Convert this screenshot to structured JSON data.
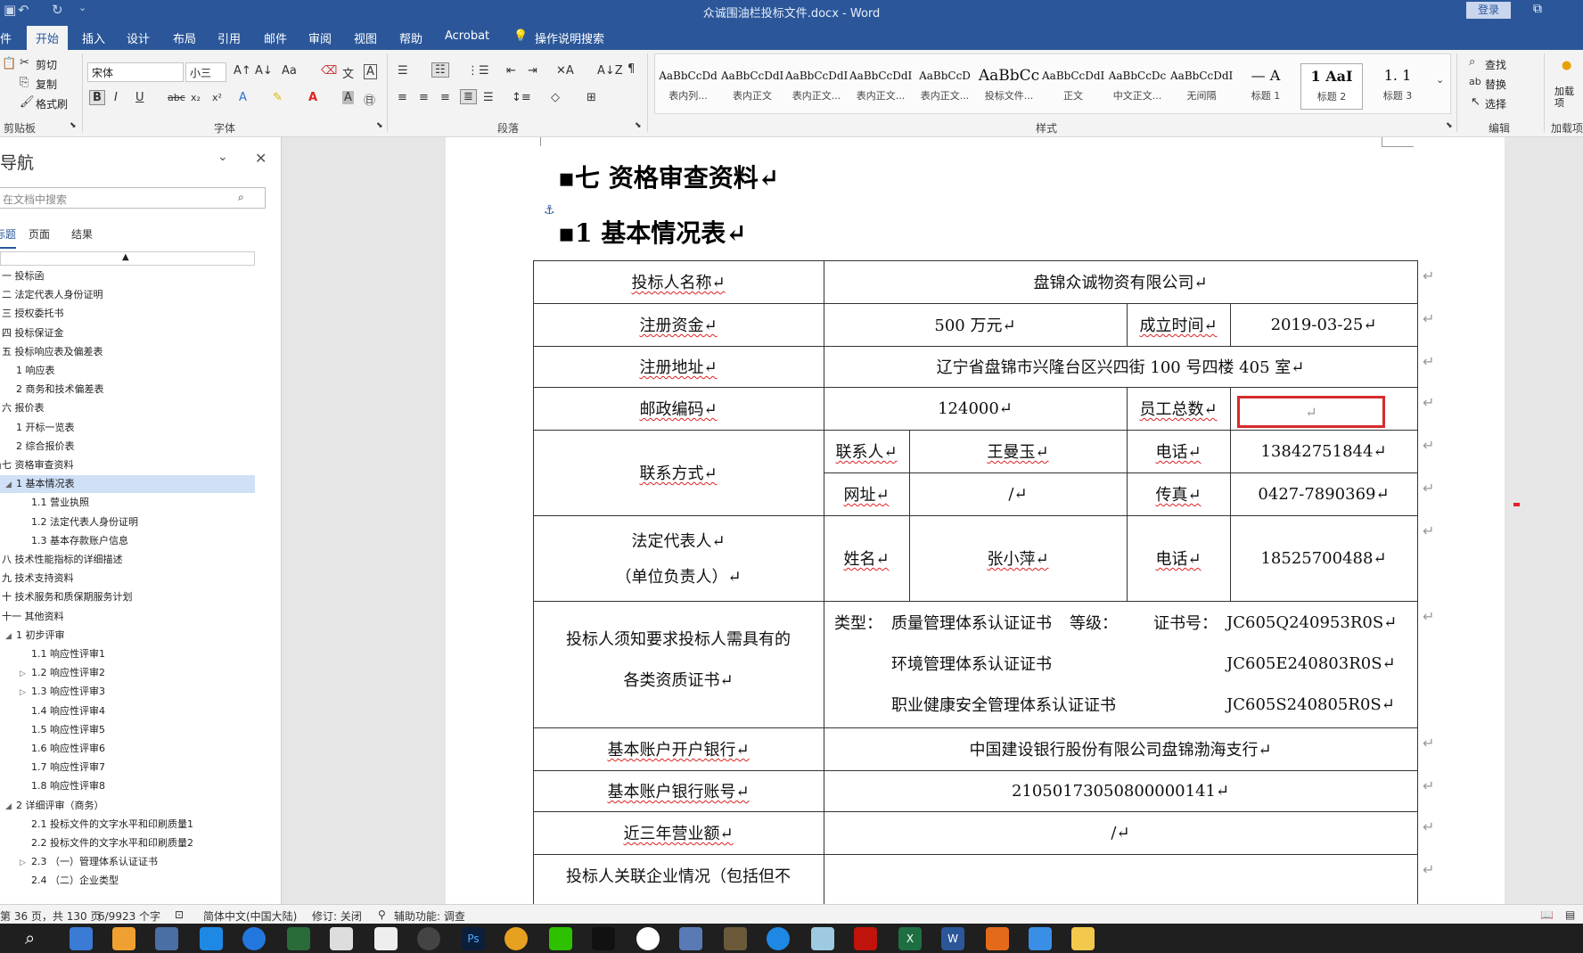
{
  "titlebar": {
    "title": "众诚围油栏投标文件.docx  -  Word",
    "login": "登录"
  },
  "tabs": [
    "件",
    "开始",
    "插入",
    "设计",
    "布局",
    "引用",
    "邮件",
    "审阅",
    "视图",
    "帮助",
    "Acrobat",
    "操作说明搜索"
  ],
  "ribbon": {
    "clipboard": {
      "cut": "剪切",
      "copy": "复制",
      "format_painter": "格式刷",
      "label": "剪贴板"
    },
    "font": {
      "name": "宋体",
      "size": "小三",
      "label": "字体"
    },
    "paragraph": {
      "label": "段落"
    },
    "styles": {
      "label": "样式",
      "items": [
        {
          "preview": "AaBbCcDd",
          "name": "表内列..."
        },
        {
          "preview": "AaBbCcDdI",
          "name": "表内正文"
        },
        {
          "preview": "AaBbCcDdI",
          "name": "表内正文..."
        },
        {
          "preview": "AaBbCcDdI",
          "name": "表内正文..."
        },
        {
          "preview": "AaBbCcD",
          "name": "表内正文..."
        },
        {
          "preview": "AaBbCc",
          "name": "投标文件..."
        },
        {
          "preview": "AaBbCcDdI",
          "name": "正文"
        },
        {
          "preview": "AaBbCcDc",
          "name": "中文正文..."
        },
        {
          "preview": "AaBbCcDdI",
          "name": "无间隔"
        },
        {
          "preview": "—  A",
          "name": "标题 1"
        },
        {
          "preview": "1   AaI",
          "name": "标题 2"
        },
        {
          "preview": "1. 1",
          "name": "标题 3"
        }
      ]
    },
    "editing": {
      "find": "查找",
      "replace": "替换",
      "select": "选择",
      "label": "编辑"
    },
    "addins": {
      "load": "加载项",
      "label": "加载项"
    }
  },
  "nav": {
    "title": "导航",
    "search_placeholder": "在文档中搜索",
    "tabs": [
      "标题",
      "页面",
      "结果"
    ],
    "items": [
      {
        "text": "一 投标函",
        "indent": 0
      },
      {
        "text": "二 法定代表人身份证明",
        "indent": 0
      },
      {
        "text": "三 授权委托书",
        "indent": 0
      },
      {
        "text": "四 投标保证金",
        "indent": 0
      },
      {
        "text": "五 投标响应表及偏差表",
        "indent": 0
      },
      {
        "text": "1 响应表",
        "indent": 1
      },
      {
        "text": "2 商务和技术偏差表",
        "indent": 1
      },
      {
        "text": "六 报价表",
        "indent": 0
      },
      {
        "text": "1 开标一览表",
        "indent": 1
      },
      {
        "text": "2 综合报价表",
        "indent": 1
      },
      {
        "text": "七 资格审查资料",
        "indent": 0
      },
      {
        "text": "1 基本情况表",
        "indent": 1,
        "selected": true
      },
      {
        "text": "1.1 营业执照",
        "indent": 2
      },
      {
        "text": "1.2 法定代表人身份证明",
        "indent": 2
      },
      {
        "text": "1.3 基本存款账户信息",
        "indent": 2
      },
      {
        "text": "八 技术性能指标的详细描述",
        "indent": 0
      },
      {
        "text": "九 技术支持资料",
        "indent": 0
      },
      {
        "text": "十 技术服务和质保期服务计划",
        "indent": 0
      },
      {
        "text": "十一 其他资料",
        "indent": 0
      },
      {
        "text": "1 初步评审",
        "indent": 1
      },
      {
        "text": "1.1 响应性评审1",
        "indent": 2
      },
      {
        "text": "1.2 响应性评审2",
        "indent": 2
      },
      {
        "text": "1.3 响应性评审3",
        "indent": 2
      },
      {
        "text": "1.4 响应性评审4",
        "indent": 2
      },
      {
        "text": "1.5 响应性评审5",
        "indent": 2
      },
      {
        "text": "1.6 响应性评审6",
        "indent": 2
      },
      {
        "text": "1.7 响应性评审7",
        "indent": 2
      },
      {
        "text": "1.8 响应性评审8",
        "indent": 2
      },
      {
        "text": "2 详细评审（商务）",
        "indent": 1
      },
      {
        "text": "2.1 投标文件的文字水平和印刷质量1",
        "indent": 2
      },
      {
        "text": "2.2 投标文件的文字水平和印刷质量2",
        "indent": 2
      },
      {
        "text": "2.3 （一）管理体系认证证书",
        "indent": 2
      },
      {
        "text": "2.4 （二）企业类型",
        "indent": 2
      }
    ]
  },
  "doc": {
    "heading1": "▪七 资格审查资料↵",
    "heading2": "▪1   基本情况表↵",
    "table": {
      "bidder_name_label": "投标人名称↵",
      "bidder_name": "盘锦众诚物资有限公司↵",
      "reg_capital_label": "注册资金↵",
      "reg_capital": "500 万元↵",
      "founded_label": "成立时间↵",
      "founded": "2019-03-25↵",
      "address_label": "注册地址↵",
      "address": "辽宁省盘锦市兴隆台区兴四街 100 号四楼 405 室↵",
      "postcode_label": "邮政编码↵",
      "postcode": "124000↵",
      "staff_label": "员工总数↵",
      "staff": "↵",
      "contact_label": "联系方式↵",
      "contact_person_label": "联系人↵",
      "contact_person": "王曼玉↵",
      "phone_label": "电话↵",
      "phone": "13842751844↵",
      "website_label": "网址↵",
      "website": "/↵",
      "fax_label": "传真↵",
      "fax": "0427-7890369↵",
      "legal_rep_label1": "法定代表人↵",
      "legal_rep_label2": "（单位负责人）↵",
      "name_label": "姓名↵",
      "legal_name": "张小萍↵",
      "phone2_label": "电话↵",
      "phone2": "18525700488↵",
      "cert_label1": "投标人须知要求投标人需具有的",
      "cert_label2": "各类资质证书↵",
      "cert_type_label": "类型：",
      "cert1": "质量管理体系认证证书",
      "grade_label": "等级：",
      "certno_label": "证书号：",
      "cert1_no": "JC605Q240953R0S↵",
      "cert2": "环境管理体系认证证书",
      "cert2_no": "JC605E240803R0S↵",
      "cert3": "职业健康安全管理体系认证证书",
      "cert3_no": "JC605S240805R0S↵",
      "bank_label": "基本账户开户银行↵",
      "bank": "中国建设银行股份有限公司盘锦渤海支行↵",
      "account_label": "基本账户银行账号↵",
      "account": "21050173050800000141↵",
      "revenue_label": "近三年营业额↵",
      "revenue": "/↵",
      "related_label": "投标人关联企业情况（包括但不"
    }
  },
  "status": {
    "page": "第 36 页，共 130 页",
    "words": "6/9923 个字",
    "lang": "简体中文(中国大陆)",
    "track": "修订: 关闭",
    "access": "辅助功能: 调查"
  },
  "colors": {
    "brand": "#2b579a",
    "highlight": "#d62b2b"
  }
}
